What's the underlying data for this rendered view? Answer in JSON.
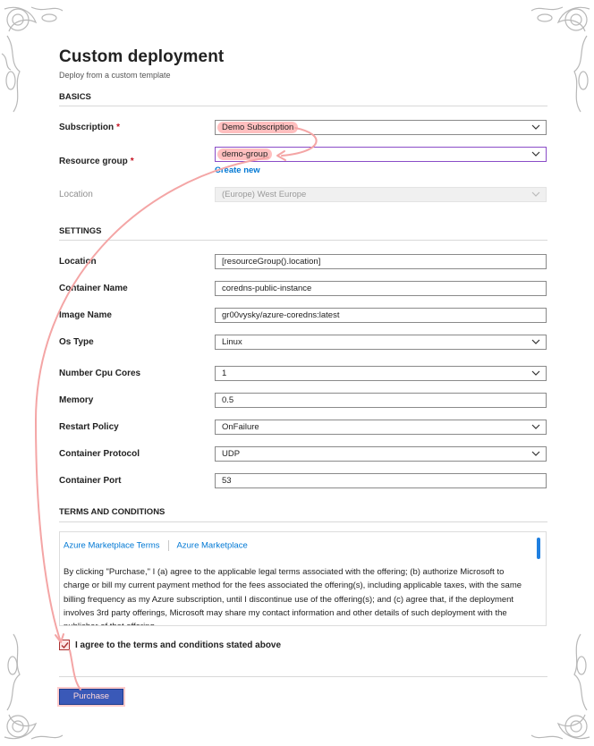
{
  "header": {
    "title": "Custom deployment",
    "subtitle": "Deploy from a custom template"
  },
  "basics": {
    "section_title": "BASICS",
    "subscription": {
      "label": "Subscription",
      "required_mark": "*",
      "value": "Demo Subscription"
    },
    "resource_group": {
      "label": "Resource group",
      "required_mark": "*",
      "value": "demo-group",
      "create_new": "Create new"
    },
    "location": {
      "label": "Location",
      "value": "(Europe) West Europe",
      "disabled": true
    }
  },
  "settings": {
    "section_title": "SETTINGS",
    "fields": [
      {
        "label": "Location",
        "value": "[resourceGroup().location]",
        "type": "text"
      },
      {
        "label": "Container Name",
        "value": "coredns-public-instance",
        "type": "text"
      },
      {
        "label": "Image Name",
        "value": "gr00vysky/azure-coredns:latest",
        "type": "text"
      },
      {
        "label": "Os Type",
        "value": "Linux",
        "type": "select"
      },
      {
        "label": "Number Cpu Cores",
        "value": "1",
        "type": "select"
      },
      {
        "label": "Memory",
        "value": "0.5",
        "type": "text"
      },
      {
        "label": "Restart Policy",
        "value": "OnFailure",
        "type": "select"
      },
      {
        "label": "Container Protocol",
        "value": "UDP",
        "type": "select"
      },
      {
        "label": "Container Port",
        "value": "53",
        "type": "text"
      }
    ]
  },
  "terms": {
    "section_title": "TERMS AND CONDITIONS",
    "links": [
      "Azure Marketplace Terms",
      "Azure Marketplace"
    ],
    "text": "By clicking \"Purchase,\" I (a) agree to the applicable legal terms associated with the offering; (b) authorize Microsoft to charge or bill my current payment method for the fees associated the offering(s), including applicable taxes, with the same billing frequency as my Azure subscription, until I discontinue use of the offering(s); and (c) agree that, if the deployment involves 3rd party offerings, Microsoft may share my contact information and other details of such deployment with the publisher of that offering.",
    "agree_label": "I agree to the terms and conditions stated above",
    "agree_checked": true
  },
  "footer": {
    "purchase_label": "Purchase"
  },
  "colors": {
    "link": "#0078d4",
    "required": "#c50f1f",
    "annotation": "#f4a5a5",
    "button": "#3a59b8",
    "scrollbar": "#1f7fe0"
  }
}
